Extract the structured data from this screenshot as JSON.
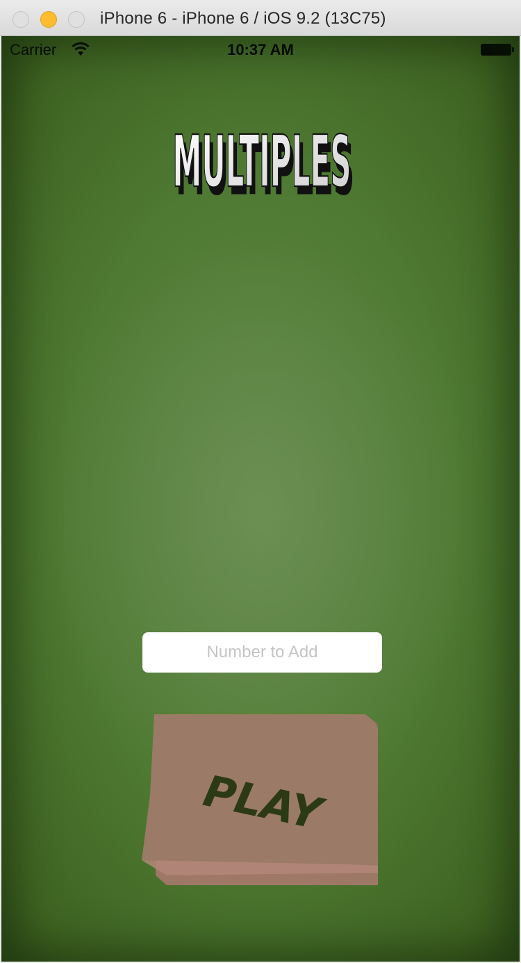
{
  "window": {
    "title": "iPhone 6 - iPhone 6 / iOS 9.2 (13C75)"
  },
  "statusbar": {
    "carrier": "Carrier",
    "time": "10:37 AM",
    "wifi_icon": "wifi-icon",
    "battery_icon": "battery-icon"
  },
  "logo": {
    "text": "MULTIPLES"
  },
  "input": {
    "placeholder": "Number to Add",
    "value": ""
  },
  "play": {
    "label": "PLAY"
  },
  "colors": {
    "chalkboard": "#4f7a33",
    "note": "#9b7a67",
    "play_text": "#2b3a14",
    "minimize": "#febc2e"
  }
}
